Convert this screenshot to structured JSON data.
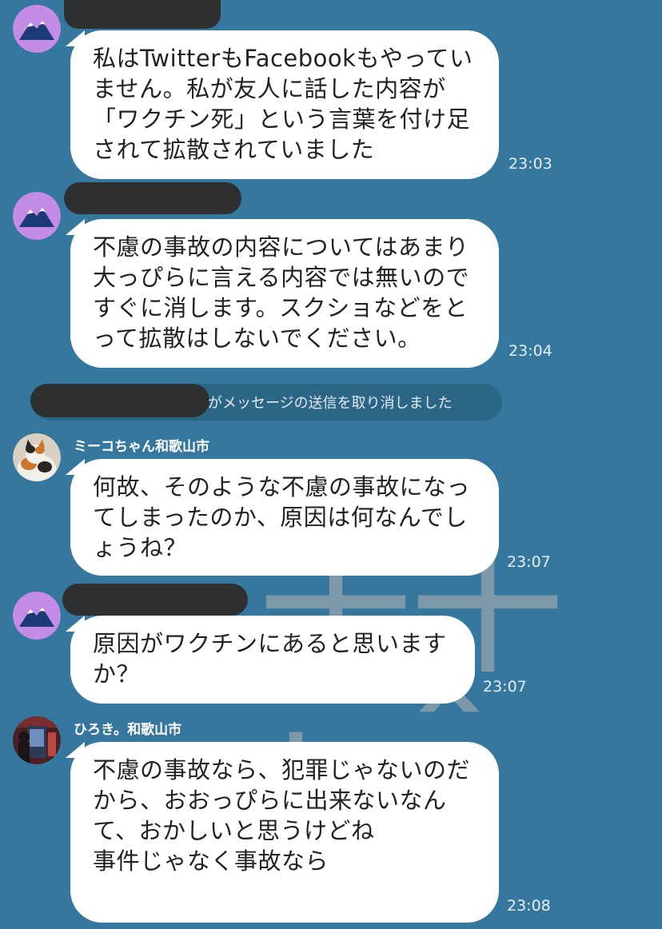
{
  "messages": [
    {
      "sender_label": "",
      "text": "私はTwitterもFacebookもやっていません。私が友人に話した内容が「ワクチン死」という言葉を付け足されて拡散されていました",
      "time": "23:03",
      "avatar": "mountain-icon"
    },
    {
      "sender_label": "",
      "text": "不慮の事故の内容についてはあまり大っぴらに言える内容では無いのですぐに消します。スクショなどをとって拡散はしないでください。",
      "time": "23:04",
      "avatar": "mountain-icon"
    },
    {
      "sender_label": "ミーコちゃん和歌山市",
      "text": "何故、そのような不慮の事故になってしまったのか、原因は何なんでしょうね？",
      "time": "23:07",
      "avatar": "cat-photo"
    },
    {
      "sender_label": "",
      "text": "原因がワクチンにあると思いますか？",
      "time": "23:07",
      "avatar": "mountain-icon"
    },
    {
      "sender_label": "ひろき。和歌山市",
      "text": "不慮の事故なら、犯罪じゃないのだから、おおっぴらに出来ないなんて、おかしいと思うけどね\n事件じゃなく事故なら",
      "time": "23:08",
      "avatar": "person-photo"
    }
  ],
  "system_message": "がメッセージの送信を取り消しました",
  "colors": {
    "background": "#35779e",
    "bubble": "#ffffff",
    "redaction": "#2e2f30",
    "avatar_mountain_bg": "#c48ce6",
    "avatar_mountain": "#1e3a74"
  }
}
